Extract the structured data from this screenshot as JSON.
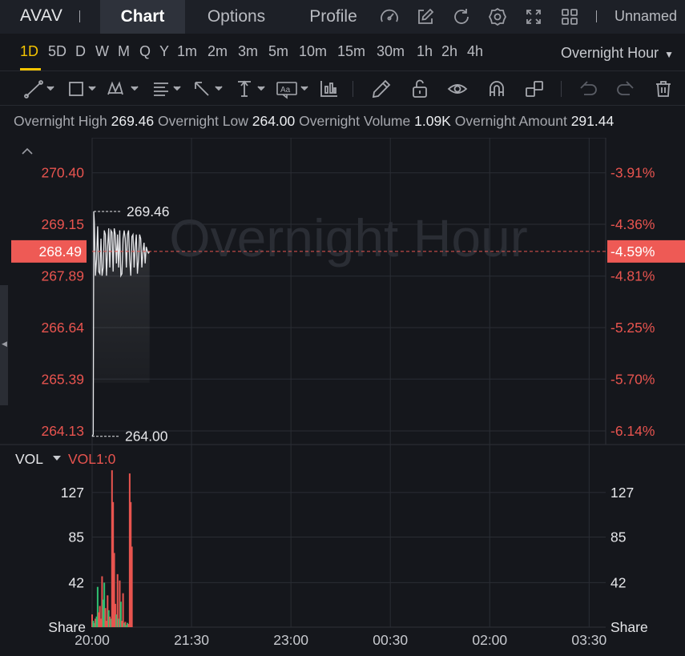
{
  "header": {
    "ticker": "AVAV",
    "tabs": [
      {
        "label": "Chart",
        "active": true
      },
      {
        "label": "Options",
        "active": false
      },
      {
        "label": "Profile",
        "active": false
      }
    ],
    "icons": [
      "gauge-icon",
      "edit-icon",
      "refresh-icon",
      "settings-icon",
      "fullscreen-icon",
      "layout-grid-icon"
    ],
    "layout_name": "Unnamed"
  },
  "timeframes": [
    "1D",
    "5D",
    "D",
    "W",
    "M",
    "Q",
    "Y",
    "1m",
    "2m",
    "3m",
    "5m",
    "10m",
    "15m",
    "30m",
    "1h",
    "2h",
    "4h"
  ],
  "active_timeframe": "1D",
  "session": {
    "label": "Overnight Hour",
    "icon": "caret-down-icon"
  },
  "drawing_tools": [
    "trend-line-icon",
    "rectangle-icon",
    "pattern-icon",
    "fib-icon",
    "arrow-icon",
    "vertical-measure-icon",
    "text-icon",
    "indicator-icon",
    "pencil-icon",
    "unlock-icon",
    "eye-icon",
    "magnet-icon",
    "copy-layout-icon",
    "undo-icon",
    "redo-icon",
    "trash-icon"
  ],
  "stats": [
    {
      "label": "Overnight High",
      "value": "269.46"
    },
    {
      "label": "Overnight Low",
      "value": "264.00"
    },
    {
      "label": "Overnight Volume",
      "value": "1.09K"
    },
    {
      "label": "Overnight Amount",
      "value": "291.44"
    }
  ],
  "watermark": "Overnight Hour",
  "colors": {
    "background": "#15171c",
    "header": "#1d2027",
    "accent": "#f5c400",
    "down": "#e8544f",
    "up": "#2fbf71",
    "line": "#e6e7ea"
  },
  "chart_data": [
    {
      "type": "line",
      "title": "",
      "y_axis_left": [
        "270.40",
        "269.15",
        "267.89",
        "266.64",
        "265.39",
        "264.13"
      ],
      "y_axis_right": [
        "-3.91%",
        "-4.36%",
        "-4.81%",
        "-5.25%",
        "-5.70%",
        "-6.14%"
      ],
      "ylim": [
        263.8,
        271.25
      ],
      "current_price": "268.49",
      "current_change": "-4.59%",
      "high_label": "269.46",
      "low_label": "264.00",
      "x_ticks": [
        "20:00",
        "21:30",
        "23:00",
        "00:30",
        "02:00",
        "03:30"
      ],
      "x_start_minutes": 1200,
      "x_end_minutes": 1665,
      "series": [
        {
          "x": [
            1200,
            1201,
            1201.5,
            1202,
            1203,
            1204,
            1205,
            1206,
            1207,
            1208,
            1209,
            1210,
            1211,
            1212,
            1213,
            1214,
            1215,
            1216,
            1217,
            1218,
            1219,
            1220,
            1221,
            1222,
            1223,
            1224,
            1225,
            1226,
            1227,
            1228,
            1229,
            1230,
            1231,
            1232,
            1233,
            1234,
            1235,
            1236,
            1237,
            1238,
            1239,
            1240,
            1241,
            1242,
            1243,
            1244,
            1245,
            1246,
            1247,
            1248,
            1249,
            1250,
            1251,
            1252
          ],
          "y": [
            264.0,
            264.05,
            269.46,
            269.2,
            267.9,
            268.3,
            269.1,
            268.0,
            267.95,
            268.8,
            267.9,
            268.1,
            269.0,
            268.9,
            267.9,
            268.6,
            269.05,
            268.1,
            269.0,
            268.95,
            268.0,
            269.05,
            268.9,
            268.2,
            268.9,
            268.1,
            269.0,
            267.9,
            267.95,
            268.8,
            269.0,
            268.8,
            268.1,
            268.9,
            269.0,
            268.3,
            267.9,
            268.85,
            268.9,
            268.1,
            268.6,
            268.9,
            267.95,
            268.3,
            268.9,
            268.8,
            268.1,
            268.5,
            268.7,
            268.2,
            268.6,
            268.5,
            268.45,
            268.49
          ]
        }
      ]
    },
    {
      "type": "bar",
      "title": "VOL",
      "indicator_label": "VOL1:0",
      "y_ticks": [
        "127",
        "85",
        "42"
      ],
      "y_unit": "Share",
      "ylim": [
        0,
        170
      ],
      "bars": [
        {
          "x": 1200,
          "v": 12,
          "dir": "down"
        },
        {
          "x": 1201,
          "v": 6,
          "dir": "up"
        },
        {
          "x": 1202,
          "v": 4,
          "dir": "up"
        },
        {
          "x": 1203,
          "v": 8,
          "dir": "down"
        },
        {
          "x": 1204,
          "v": 10,
          "dir": "up"
        },
        {
          "x": 1205,
          "v": 38,
          "dir": "up"
        },
        {
          "x": 1206,
          "v": 14,
          "dir": "down"
        },
        {
          "x": 1207,
          "v": 20,
          "dir": "down"
        },
        {
          "x": 1208,
          "v": 8,
          "dir": "down"
        },
        {
          "x": 1209,
          "v": 48,
          "dir": "down"
        },
        {
          "x": 1210,
          "v": 26,
          "dir": "up"
        },
        {
          "x": 1211,
          "v": 42,
          "dir": "up"
        },
        {
          "x": 1212,
          "v": 18,
          "dir": "down"
        },
        {
          "x": 1213,
          "v": 6,
          "dir": "down"
        },
        {
          "x": 1214,
          "v": 30,
          "dir": "down"
        },
        {
          "x": 1215,
          "v": 16,
          "dir": "up"
        },
        {
          "x": 1216,
          "v": 10,
          "dir": "down"
        },
        {
          "x": 1217,
          "v": 8,
          "dir": "up"
        },
        {
          "x": 1218,
          "v": 148,
          "dir": "down"
        },
        {
          "x": 1219,
          "v": 118,
          "dir": "down"
        },
        {
          "x": 1220,
          "v": 70,
          "dir": "down"
        },
        {
          "x": 1221,
          "v": 22,
          "dir": "down"
        },
        {
          "x": 1222,
          "v": 12,
          "dir": "up"
        },
        {
          "x": 1223,
          "v": 50,
          "dir": "down"
        },
        {
          "x": 1224,
          "v": 8,
          "dir": "up"
        },
        {
          "x": 1225,
          "v": 44,
          "dir": "down"
        },
        {
          "x": 1226,
          "v": 24,
          "dir": "up"
        },
        {
          "x": 1227,
          "v": 6,
          "dir": "down"
        },
        {
          "x": 1228,
          "v": 32,
          "dir": "down"
        },
        {
          "x": 1229,
          "v": 4,
          "dir": "up"
        },
        {
          "x": 1230,
          "v": 5,
          "dir": "down"
        },
        {
          "x": 1231,
          "v": 2,
          "dir": "up"
        },
        {
          "x": 1232,
          "v": 4,
          "dir": "up"
        },
        {
          "x": 1233,
          "v": 3,
          "dir": "down"
        },
        {
          "x": 1234,
          "v": 145,
          "dir": "down"
        },
        {
          "x": 1235,
          "v": 118,
          "dir": "down"
        },
        {
          "x": 1236,
          "v": 76,
          "dir": "down"
        }
      ]
    }
  ]
}
